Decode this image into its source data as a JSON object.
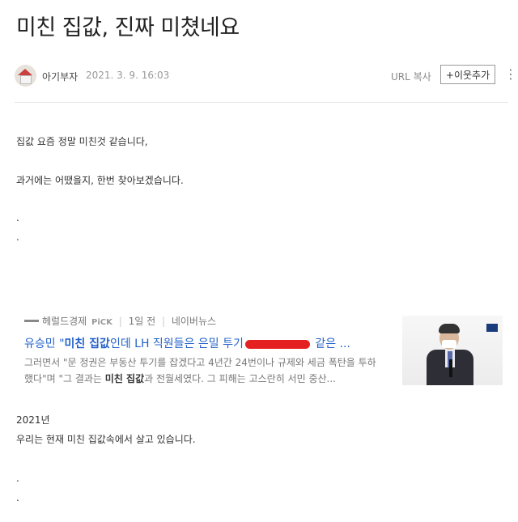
{
  "post": {
    "title": "미친 집값, 진짜 미쳤네요",
    "author": "아기부자",
    "date": "2021. 3. 9. 16:03",
    "url_copy": "URL 복사",
    "follow": "+이웃추가",
    "more": "⋮"
  },
  "body": {
    "line1": "집값 요즘 정말 미친것 같습니다,",
    "line2": "과거에는 어땠을지, 한번 찾아보겠습니다.",
    "dot": ".",
    "year": "2021년",
    "line3": "우리는 현재 미친 집값속에서 살고 있습니다."
  },
  "news_card": {
    "press": "헤럴드경제",
    "pick": "PiCK",
    "time": "1일 전",
    "source": "네이버뉴스",
    "headline_pre": "유승민 \"",
    "headline_bold": "미친 집값",
    "headline_mid": "인데 LH 직원들은 은밀 투기",
    "headline_post": " 같은 ...",
    "summary_1": "그러면서 \"문 정권은 부동산 투기를 잡겠다고 4년간 24번이나 규제와 세금 폭탄을 투하했다\"며 \"그 결과는 ",
    "summary_bold": "미친 집값",
    "summary_2": "과 전월세였다. 그 피해는 고스란히 서민 중산..."
  }
}
